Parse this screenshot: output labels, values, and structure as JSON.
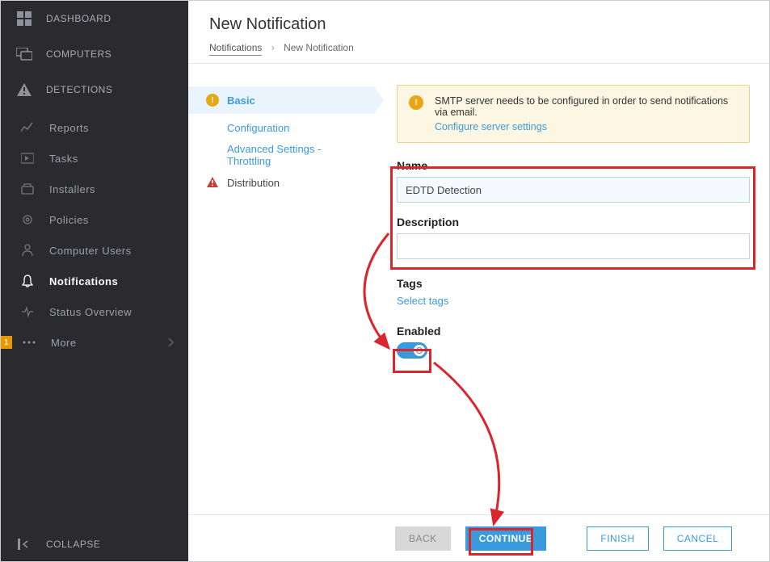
{
  "sidebar": {
    "dashboard": "DASHBOARD",
    "computers": "COMPUTERS",
    "detections": "DETECTIONS",
    "items": [
      {
        "label": "Reports"
      },
      {
        "label": "Tasks"
      },
      {
        "label": "Installers"
      },
      {
        "label": "Policies"
      },
      {
        "label": "Computer Users"
      },
      {
        "label": "Notifications"
      },
      {
        "label": "Status Overview"
      },
      {
        "label": "More"
      }
    ],
    "more_badge": "1",
    "collapse": "COLLAPSE"
  },
  "header": {
    "title": "New Notification",
    "breadcrumb_root": "Notifications",
    "breadcrumb_current": "New Notification"
  },
  "steps": {
    "basic": "Basic",
    "configuration": "Configuration",
    "advanced": "Advanced Settings - Throttling",
    "distribution": "Distribution"
  },
  "alert": {
    "text": "SMTP server needs to be configured in order to send notifications via email.",
    "link": "Configure server settings"
  },
  "form": {
    "name_label": "Name",
    "name_value": "EDTD Detection",
    "description_label": "Description",
    "description_value": "",
    "tags_label": "Tags",
    "tags_link": "Select tags",
    "enabled_label": "Enabled"
  },
  "footer": {
    "back": "BACK",
    "continue": "CONTINUE",
    "finish": "FINISH",
    "cancel": "CANCEL"
  }
}
